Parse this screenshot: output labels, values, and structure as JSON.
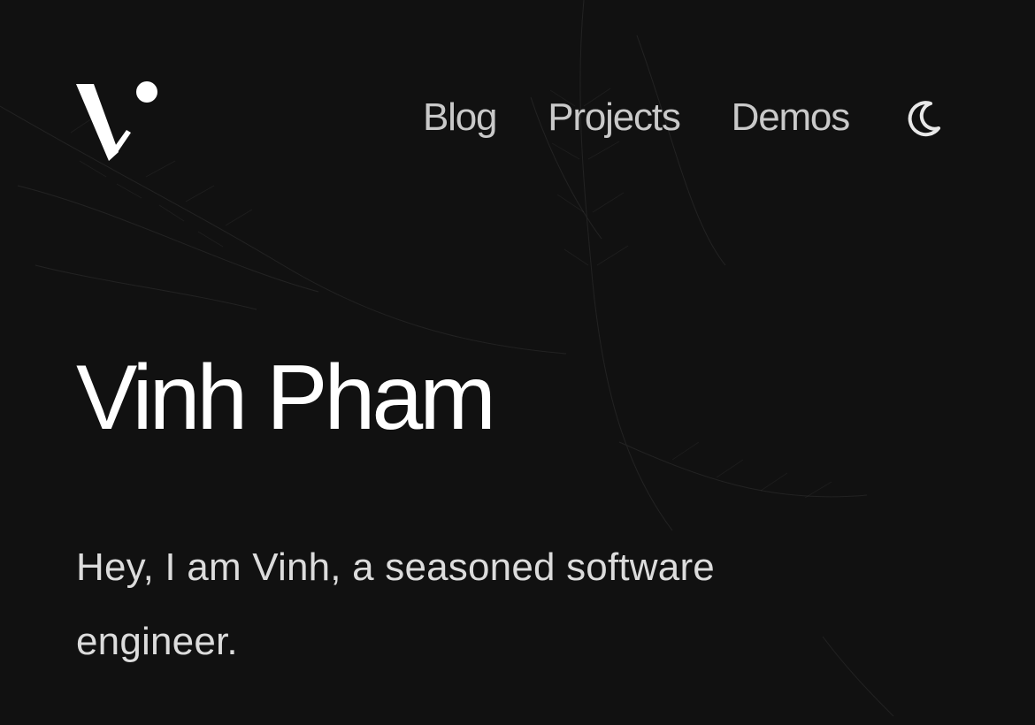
{
  "site": {
    "logo_icon": "v-logo-icon"
  },
  "nav": {
    "items": [
      {
        "label": "Blog"
      },
      {
        "label": "Projects"
      },
      {
        "label": "Demos"
      }
    ],
    "theme_toggle_icon": "moon-icon"
  },
  "hero": {
    "title": "Vinh Pham",
    "intro": "Hey, I am Vinh, a seasoned software engineer."
  },
  "colors": {
    "background": "#111111",
    "nav_text": "#c9c9c9",
    "title_text": "#ffffff",
    "body_text": "#dcdcdc"
  }
}
